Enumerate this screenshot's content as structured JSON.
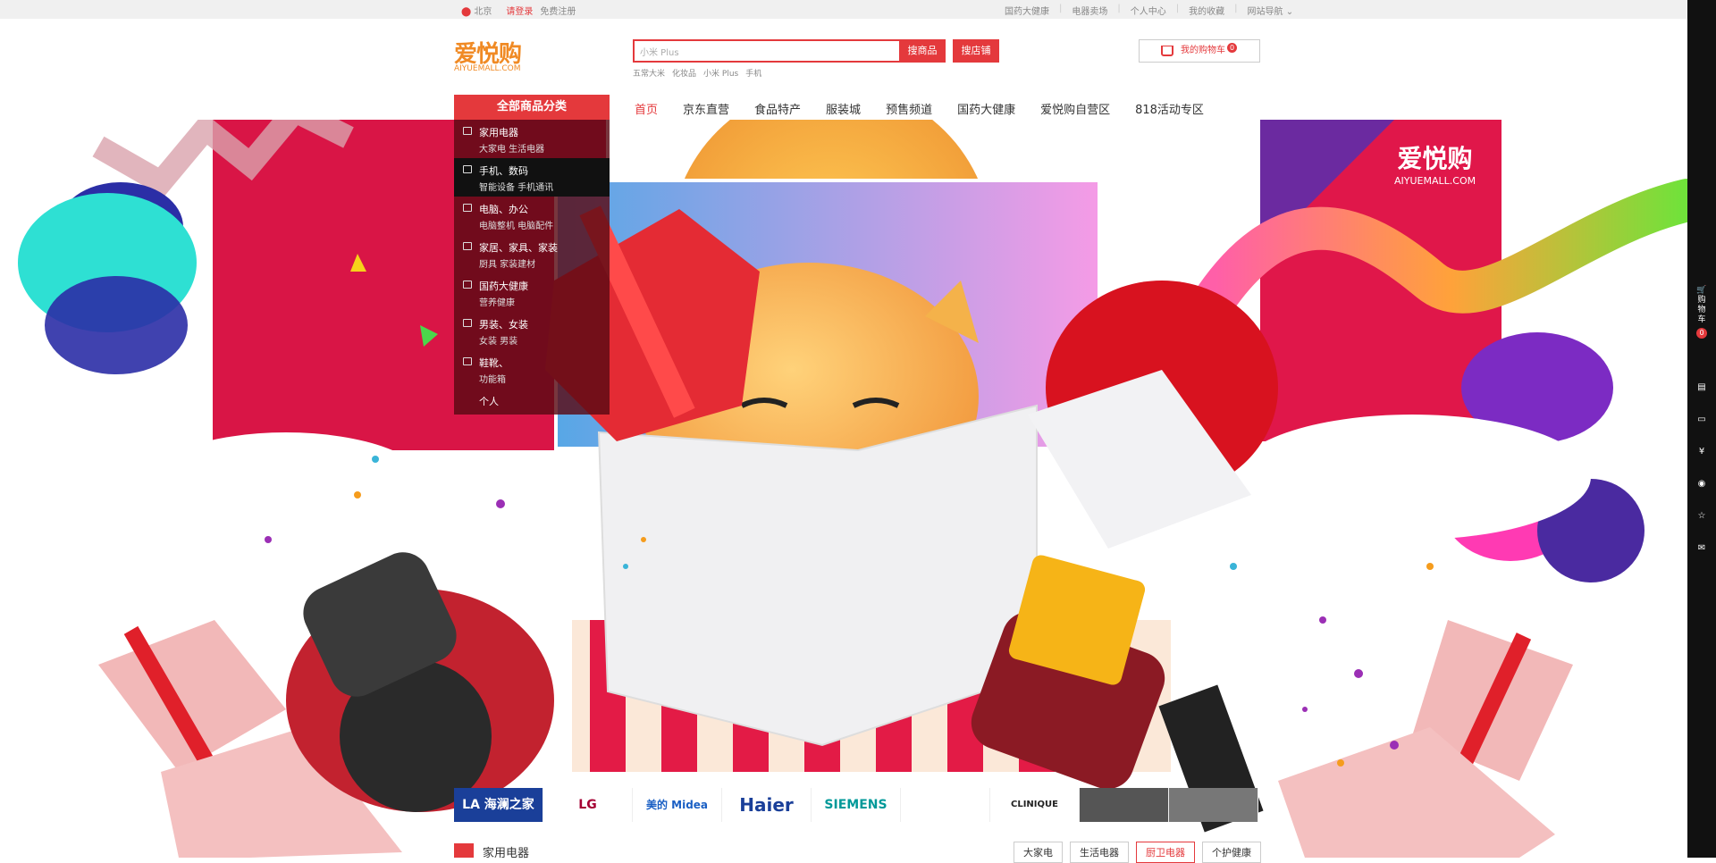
{
  "topbar": {
    "location": "北京",
    "login": "请登录",
    "register": "免费注册",
    "links": [
      "国药大健康",
      "电器卖场",
      "个人中心",
      "我的收藏",
      "网站导航"
    ]
  },
  "logo": {
    "cn": "爱悦购",
    "en": "AIYUEMALL.COM"
  },
  "search": {
    "placeholder": "小米 Plus",
    "search_button": "搜商品",
    "shop_button": "搜店铺",
    "hot_words": [
      "五常大米",
      "化妆品",
      "小米 Plus",
      "手机"
    ]
  },
  "cart": {
    "label": "我的购物车",
    "count": "0"
  },
  "category_title": "全部商品分类",
  "nav": [
    "首页",
    "京东直营",
    "食品特产",
    "服装城",
    "预售频道",
    "国药大健康",
    "爱悦购自营区",
    "818活动专区"
  ],
  "categories": [
    {
      "title": "家用电器",
      "sub": "大家电  生活电器"
    },
    {
      "title": "手机、数码",
      "sub": "智能设备  手机通讯"
    },
    {
      "title": "电脑、办公",
      "sub": "电脑整机  电脑配件"
    },
    {
      "title": "家居、家具、家装",
      "sub": "厨具  家装建材"
    },
    {
      "title": "国药大健康",
      "sub": "营养健康"
    },
    {
      "title": "男装、女装",
      "sub": "女装  男装"
    },
    {
      "title": "鞋靴、",
      "sub": "功能箱"
    }
  ],
  "category_more": "个人",
  "banner_logo": {
    "cn": "爱悦购",
    "en": "AIYUEMALL.COM"
  },
  "right_sidebar": {
    "cart_label": "购物车",
    "cart_count": "0"
  },
  "brands": [
    "LA 海澜之家",
    "LG",
    "美的 Midea",
    "Haier",
    "SIEMENS",
    "",
    "CLINIQUE",
    "",
    ""
  ],
  "floor": {
    "title": "家用电器",
    "tabs": [
      "大家电",
      "生活电器",
      "厨卫电器",
      "个护健康"
    ],
    "selected_tab": "厨卫电器"
  },
  "colors": {
    "accent": "#e4393c",
    "logo": "#f08a24"
  }
}
